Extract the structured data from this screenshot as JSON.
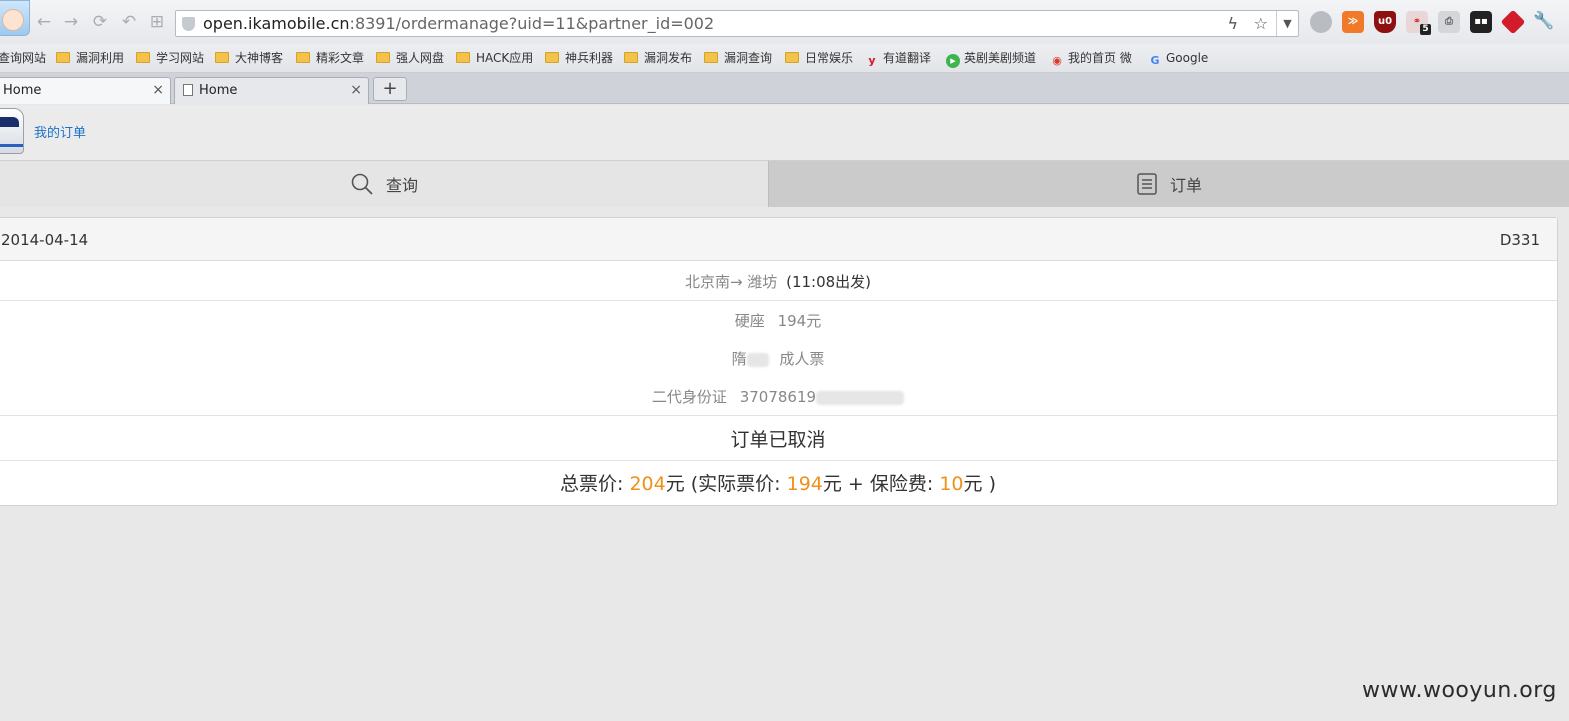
{
  "browser": {
    "url_host": "open.ikamobile.cn",
    "url_rest": ":8391/ordermanage?uid=11&partner_id=002",
    "bookmarks": [
      "查询网站",
      "漏洞利用",
      "学习网站",
      "大神博客",
      "精彩文章",
      "强人网盘",
      "HACK应用",
      "神兵利器",
      "漏洞发布",
      "漏洞查询",
      "日常娱乐",
      "有道翻译",
      "英剧美剧频道",
      "我的首页 微",
      "Google"
    ],
    "tabs": [
      {
        "label": "Home"
      },
      {
        "label": "Home"
      }
    ],
    "new_tab_label": "+",
    "tab_close_glyph": "×",
    "extension_badge": "5"
  },
  "app": {
    "header_title": "我的订单",
    "segments": {
      "query": "查询",
      "orders": "订单"
    }
  },
  "order": {
    "date": "2014-04-14",
    "train": "D331",
    "route": "北京南→ 潍坊",
    "departure": "(11:08出发)",
    "seat_type": "硬座",
    "seat_price": "194元",
    "passenger_visible": "隋",
    "ticket_type": "成人票",
    "id_type": "二代身份证",
    "id_visible": "37078619",
    "status": "订单已取消",
    "price_summary": {
      "label_total": "总票价: ",
      "total": "204",
      "unit_after_total": "元 (实际票价: ",
      "actual": "194",
      "unit_after_actual": "元 + 保险费: ",
      "insurance": "10",
      "closing": "元 )"
    }
  },
  "watermark": "www.wooyun.org",
  "colors": {
    "accent_blue": "#1b72c8",
    "price_orange": "#f0901a"
  }
}
